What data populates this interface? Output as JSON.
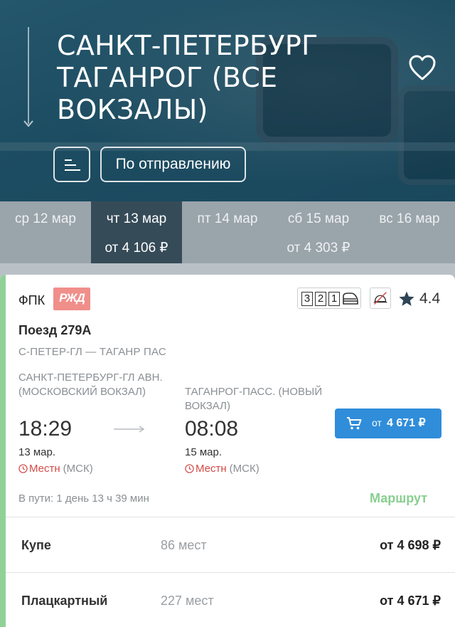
{
  "header": {
    "title_lines": [
      "САНКТ-ПЕТЕРБУРГ",
      "ТАГАНРОГ (ВСЕ",
      "ВОКЗАЛЫ)"
    ],
    "sort_label": "По отправлению",
    "icons": {
      "favorite": "heart-outline-icon",
      "sort": "sort-lines-icon",
      "scroll": "arrow-down-icon"
    }
  },
  "dates": [
    {
      "day": "ср 12 мар",
      "price": ""
    },
    {
      "day": "чт 13 мар",
      "price": "от 4 106 ₽",
      "selected": true
    },
    {
      "day": "пт 14 мар",
      "price": ""
    },
    {
      "day": "сб 15 мар",
      "price": "от 4 303 ₽"
    },
    {
      "day": "вс 16 мар",
      "price": ""
    }
  ],
  "train": {
    "carrier": "ФПК",
    "carrier_logo": "РЖД",
    "classes": [
      "3",
      "2",
      "1"
    ],
    "rating": "4.4",
    "name": "Поезд 279А",
    "route": "С-ПЕТЕР-ГЛ — ТАГАНР ПАС",
    "departure": {
      "station": "САНКТ-ПЕТЕРБУРГ-ГЛ АВН. (МОСКОВСКИЙ ВОКЗАЛ)",
      "time": "18:29",
      "date": "13 мар.",
      "tz_local": "Местн",
      "tz_msk": "(МСК)"
    },
    "arrival": {
      "station": "ТАГАНРОГ-ПАСС. (НОВЫЙ ВОКЗАЛ)",
      "time": "08:08",
      "date": "15 мар.",
      "tz_local": "Местн",
      "tz_msk": "(МСК)"
    },
    "buy": {
      "prefix": "от",
      "amount": "4 671 ₽"
    },
    "duration": "В пути: 1 день 13 ч 39 мин",
    "route_link": "Маршрут",
    "seats": [
      {
        "type": "Купе",
        "count": "86 мест",
        "price": "от 4 698 ₽"
      },
      {
        "type": "Плацкартный",
        "count": "227 мест",
        "price": "от 4 671 ₽"
      }
    ]
  },
  "colors": {
    "header_bg": "#1d4d62",
    "accent": "#8fd197",
    "buy_button": "#2f8dda",
    "local_tz": "#d24a45",
    "rzd": "#f08e8a"
  }
}
